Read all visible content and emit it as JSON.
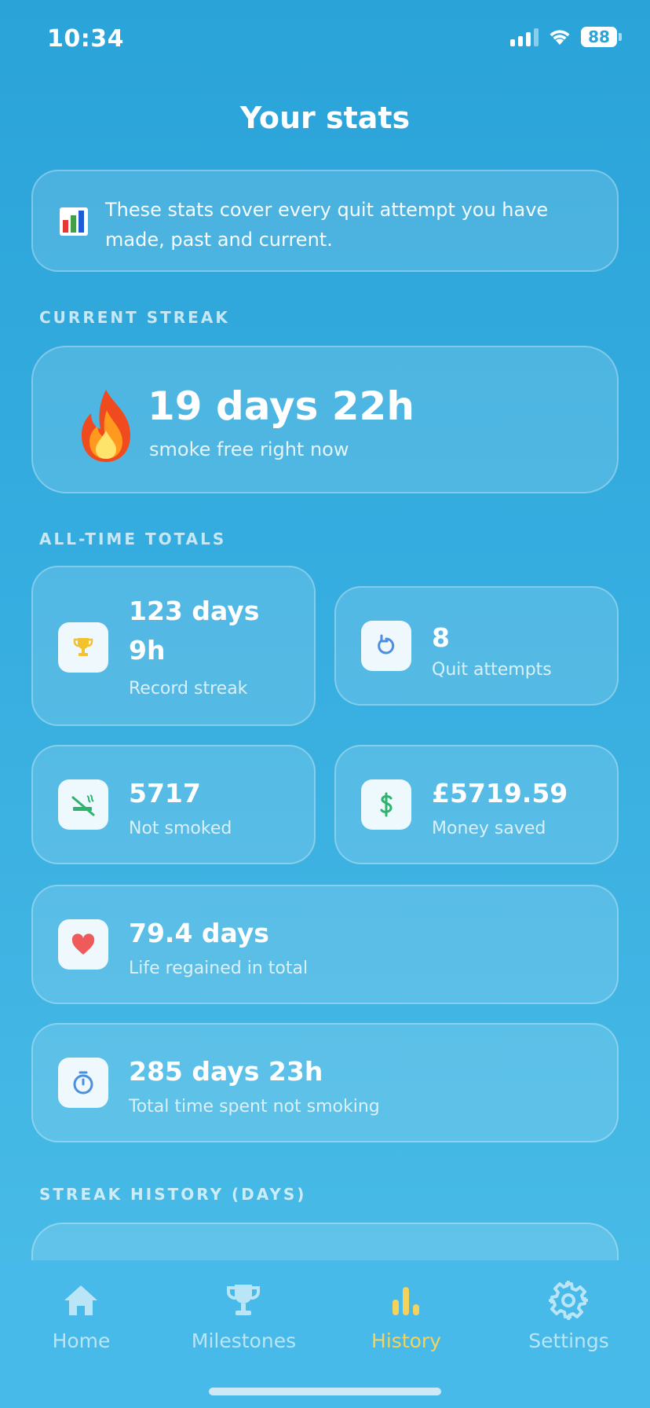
{
  "status_bar": {
    "time": "10:34",
    "battery": "88"
  },
  "page_title": "Your stats",
  "info": {
    "text": "These stats cover every quit attempt you have made, past and current."
  },
  "sections": {
    "current_streak": "CURRENT STREAK",
    "all_time_totals": "ALL-TIME TOTALS",
    "streak_history": "STREAK HISTORY (DAYS)"
  },
  "current_streak": {
    "value": "19 days 22h",
    "subtitle": "smoke free right now"
  },
  "totals": {
    "record_streak": {
      "value_line1": "123 days",
      "value_line2": "9h",
      "label": "Record streak",
      "icon": "trophy-icon",
      "color": "#f2c12e"
    },
    "quit_attempts": {
      "value": "8",
      "label": "Quit attempts",
      "icon": "restart-icon",
      "color": "#4a8fe0"
    },
    "not_smoked": {
      "value": "5717",
      "label": "Not smoked",
      "icon": "no-smoking-icon",
      "color": "#2db36b"
    },
    "money_saved": {
      "value": "£5719.59",
      "label": "Money saved",
      "icon": "dollar-icon",
      "color": "#2db36b"
    },
    "life_regained": {
      "value": "79.4 days",
      "label": "Life regained in total",
      "icon": "heart-icon",
      "color": "#ef5b5b"
    },
    "total_time": {
      "value": "285 days 23h",
      "label": "Total time spent not smoking",
      "icon": "stopwatch-icon",
      "color": "#4a8fe0"
    }
  },
  "tabs": [
    {
      "label": "Home",
      "icon": "home-icon",
      "active": false
    },
    {
      "label": "Milestones",
      "icon": "trophy-icon",
      "active": false
    },
    {
      "label": "History",
      "icon": "bar-chart-icon",
      "active": true
    },
    {
      "label": "Settings",
      "icon": "gear-icon",
      "active": false
    }
  ],
  "colors": {
    "accent_active": "#f5d35a",
    "background": "#2aa3d9"
  }
}
